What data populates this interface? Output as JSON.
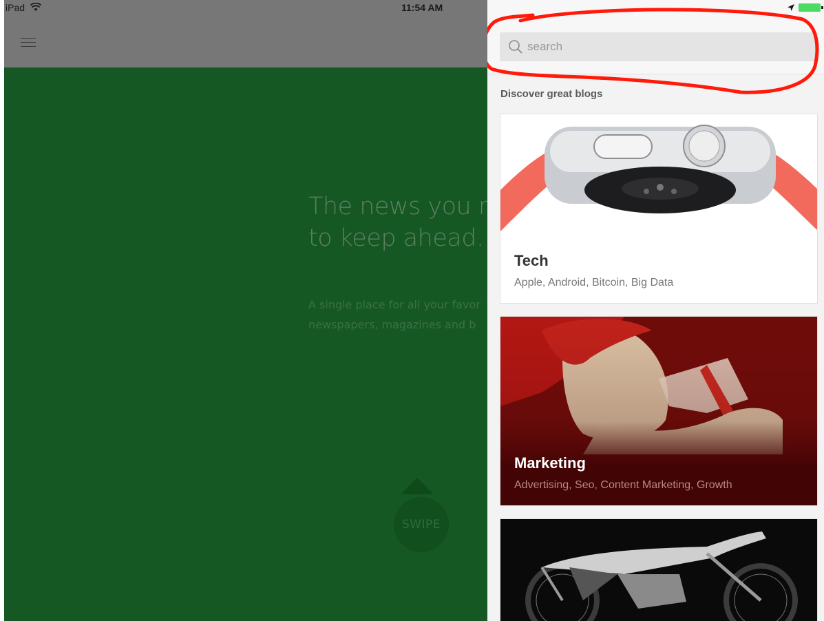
{
  "status_bar": {
    "device": "iPad",
    "time": "11:54 AM",
    "wifi_icon": "wifi-icon",
    "location_icon": "location-arrow-icon",
    "battery_icon": "battery-icon"
  },
  "background_app": {
    "menu_icon": "hamburger-menu-icon",
    "hero_title_line1": "The news you ne",
    "hero_title_line2": "to keep ahead.",
    "hero_sub_line1": "A single place for all your favor",
    "hero_sub_line2": "newspapers, magazines and b",
    "swipe_label": "SWIPE",
    "color": "#165824"
  },
  "panel": {
    "search": {
      "placeholder": "search",
      "icon": "search-icon"
    },
    "section_title": "Discover great blogs",
    "cards": [
      {
        "title": "Tech",
        "subtitle": "Apple, Android, Bitcoin, Big Data",
        "image": "smartwatch-image"
      },
      {
        "title": "Marketing",
        "subtitle": "Advertising, Seo, Content Marketing, Growth",
        "image": "vintage-advertising-image"
      },
      {
        "title": "",
        "subtitle": "",
        "image": "motorcycle-image"
      }
    ],
    "annotation_color": "#ff1a0a"
  }
}
